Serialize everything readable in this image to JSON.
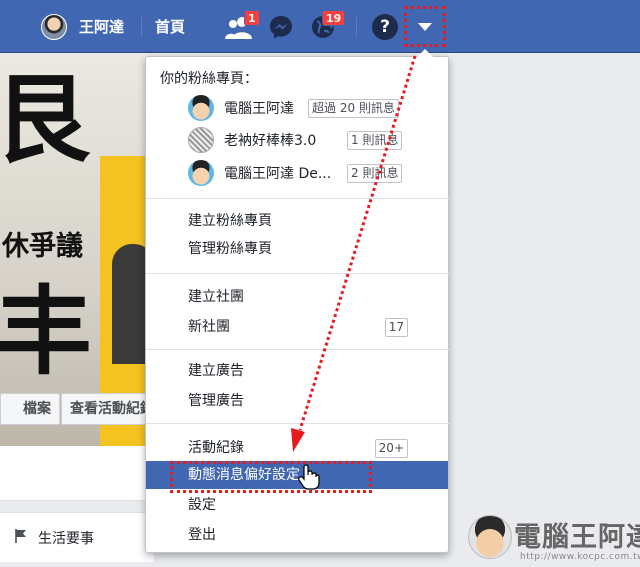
{
  "topbar": {
    "profile_name": "王阿達",
    "home": "首頁",
    "friend_requests_badge": "1",
    "notifications_badge": "19",
    "help": "?"
  },
  "background": {
    "slogan": "休爭議",
    "glyph_top": "艮",
    "glyph_bottom": "丰",
    "profile_button": "檔案",
    "activity_button": "查看活動紀錄",
    "life_events_tab": "生活要事"
  },
  "menu": {
    "header": "你的粉絲專頁：",
    "pages": [
      {
        "name": "電腦王阿達",
        "tag": "超過 20 則訊息"
      },
      {
        "name": "老衲好棒棒3.0",
        "tag": "1 則訊息"
      },
      {
        "name": "電腦王阿達 De...",
        "tag": "2 則訊息"
      }
    ],
    "items": {
      "create_page": "建立粉絲專頁",
      "manage_pages": "管理粉絲專頁",
      "create_group": "建立社團",
      "new_groups": "新社團",
      "new_groups_badge": "17",
      "create_ads": "建立廣告",
      "manage_ads": "管理廣告",
      "activity_log": "活動紀錄",
      "activity_log_badge": "20+",
      "news_feed_prefs": "動態消息偏好設定",
      "settings": "設定",
      "logout": "登出"
    }
  },
  "watermark": {
    "title": "電腦王阿達",
    "url": "http://www.kocpc.com.tw"
  },
  "colors": {
    "facebook_blue": "#4267b2",
    "badge_red": "#fa3e3e",
    "annotation_red": "#e8191f"
  }
}
